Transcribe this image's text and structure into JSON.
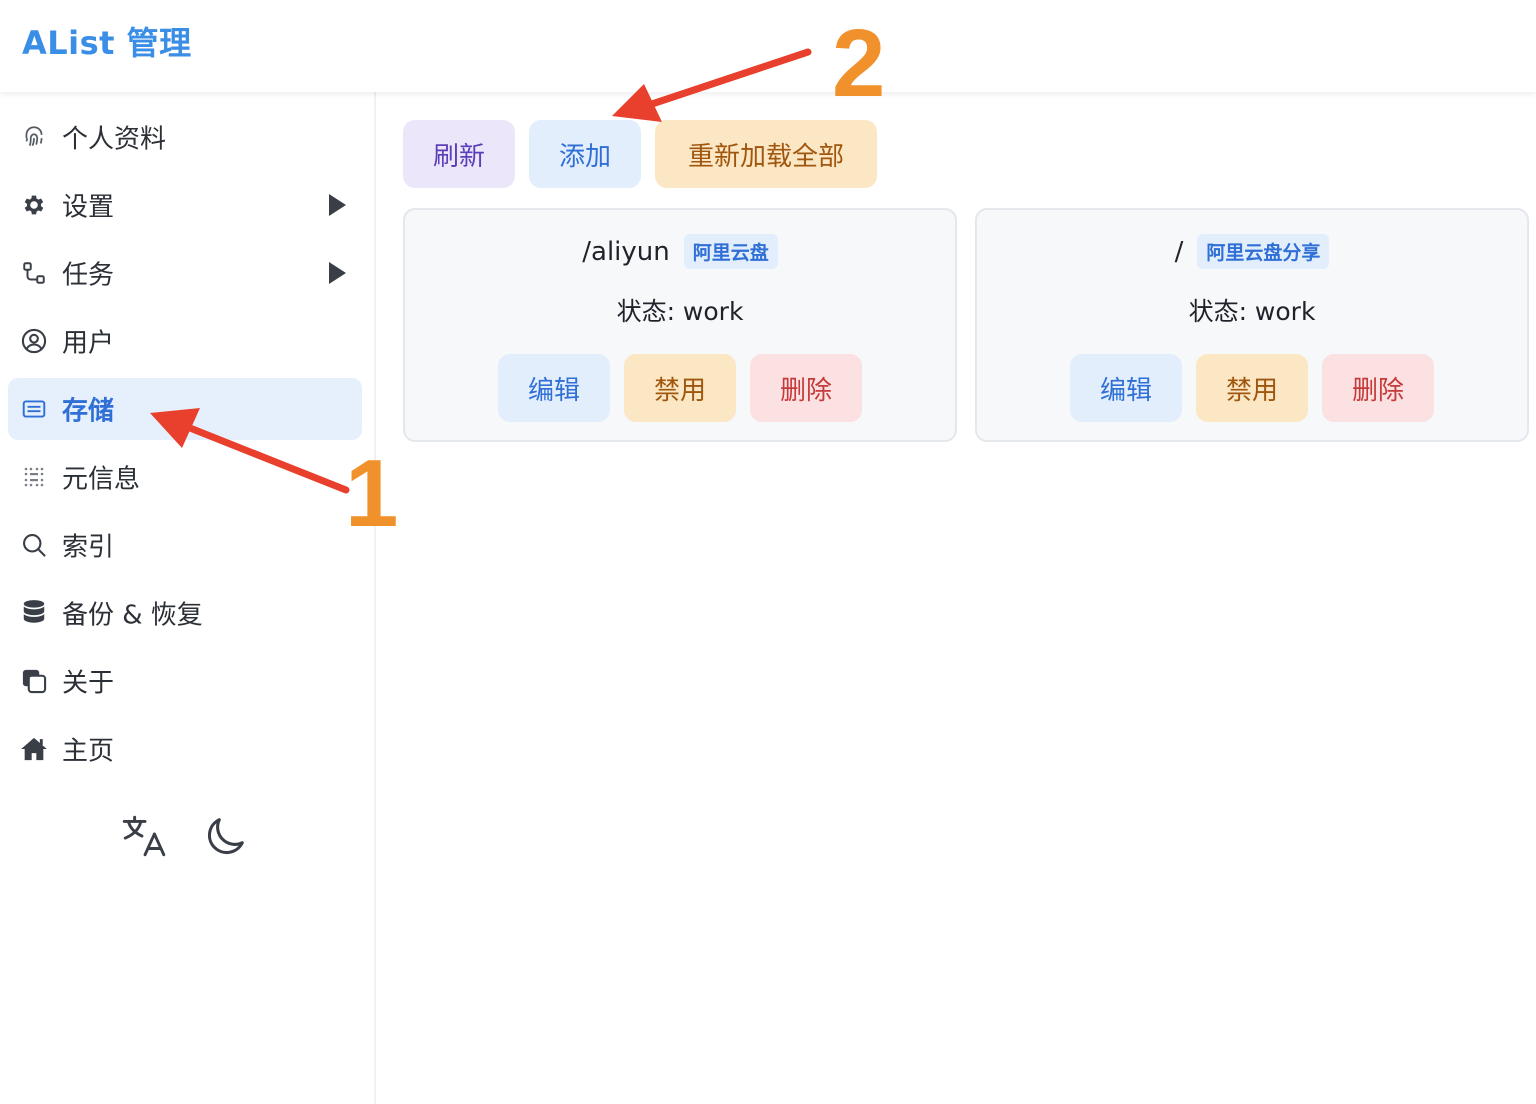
{
  "app": {
    "title": "AList 管理"
  },
  "sidebar": {
    "items": [
      {
        "label": "个人资料",
        "icon": "fingerprint-icon",
        "has_submenu": false,
        "active": false
      },
      {
        "label": "设置",
        "icon": "gear-icon",
        "has_submenu": true,
        "active": false
      },
      {
        "label": "任务",
        "icon": "task-flow-icon",
        "has_submenu": true,
        "active": false
      },
      {
        "label": "用户",
        "icon": "user-circle-icon",
        "has_submenu": false,
        "active": false
      },
      {
        "label": "存储",
        "icon": "storage-icon",
        "has_submenu": false,
        "active": true
      },
      {
        "label": "元信息",
        "icon": "meta-grid-icon",
        "has_submenu": false,
        "active": false
      },
      {
        "label": "索引",
        "icon": "search-icon",
        "has_submenu": false,
        "active": false
      },
      {
        "label": "备份 & 恢复",
        "icon": "database-icon",
        "has_submenu": false,
        "active": false
      },
      {
        "label": "关于",
        "icon": "copy-icon",
        "has_submenu": false,
        "active": false
      },
      {
        "label": "主页",
        "icon": "home-icon",
        "has_submenu": false,
        "active": false
      }
    ],
    "tools": {
      "language_icon": "translate-icon",
      "theme_icon": "moon-icon"
    }
  },
  "toolbar": {
    "refresh_label": "刷新",
    "add_label": "添加",
    "reload_all_label": "重新加载全部"
  },
  "storages": [
    {
      "mount_path": "/aliyun",
      "driver": "阿里云盘",
      "status": "状态: work",
      "edit_label": "编辑",
      "disable_label": "禁用",
      "delete_label": "删除"
    },
    {
      "mount_path": "/",
      "driver": "阿里云盘分享",
      "status": "状态: work",
      "edit_label": "编辑",
      "disable_label": "禁用",
      "delete_label": "删除"
    }
  ],
  "annotations": {
    "step1": "1",
    "step2": "2",
    "arrow_color": "#e8402c",
    "number_color": "#f0912c"
  },
  "colors": {
    "brand": "#3a8ee6",
    "active_bg": "#e6f0fd",
    "primary": "#2f6fd6"
  }
}
